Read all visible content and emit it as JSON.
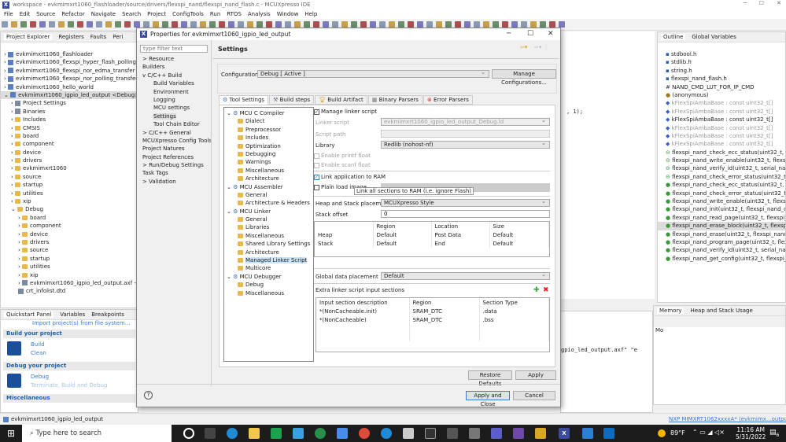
{
  "window": {
    "title": "workspace - evkmimxrt1060_flashloader/source/drivers/flexspi_nand/flexspi_nand_flash.c - MCUXpresso IDE"
  },
  "menu": [
    "File",
    "Edit",
    "Source",
    "Refactor",
    "Navigate",
    "Search",
    "Project",
    "ConfigTools",
    "Run",
    "RTOS",
    "Analysis",
    "Window",
    "Help"
  ],
  "explorer": {
    "tabs": [
      "Project Explorer",
      "Registers",
      "Faults",
      "Peri"
    ],
    "items": [
      {
        "t": "evkmimxrt1060_flashloader",
        "d": 0,
        "k": "p"
      },
      {
        "t": "evkmimxrt1060_flexspi_hyper_flash_polling_transfer",
        "d": 0,
        "k": "p"
      },
      {
        "t": "evkmimxrt1060_flexspi_nor_edma_transfer",
        "d": 0,
        "k": "p"
      },
      {
        "t": "evkmimxrt1060_flexspi_nor_polling_transfer",
        "d": 0,
        "k": "p"
      },
      {
        "t": "evkmimxrt1060_hello_world",
        "d": 0,
        "k": "p"
      },
      {
        "t": "evkmimxrt1060_igpio_led_output <Debug>",
        "d": 0,
        "k": "p",
        "sel": true
      },
      {
        "t": "Project Settings",
        "d": 1,
        "k": "g"
      },
      {
        "t": "Binaries",
        "d": 1,
        "k": "g"
      },
      {
        "t": "Includes",
        "d": 1,
        "k": "f"
      },
      {
        "t": "CMSIS",
        "d": 1,
        "k": "f"
      },
      {
        "t": "board",
        "d": 1,
        "k": "f"
      },
      {
        "t": "component",
        "d": 1,
        "k": "f"
      },
      {
        "t": "device",
        "d": 1,
        "k": "f"
      },
      {
        "t": "drivers",
        "d": 1,
        "k": "f"
      },
      {
        "t": "evkmimxrt1060",
        "d": 1,
        "k": "f"
      },
      {
        "t": "source",
        "d": 1,
        "k": "f"
      },
      {
        "t": "startup",
        "d": 1,
        "k": "f"
      },
      {
        "t": "utilities",
        "d": 1,
        "k": "f"
      },
      {
        "t": "xip",
        "d": 1,
        "k": "f"
      },
      {
        "t": "Debug",
        "d": 1,
        "k": "f"
      },
      {
        "t": "board",
        "d": 2,
        "k": "f"
      },
      {
        "t": "component",
        "d": 2,
        "k": "f"
      },
      {
        "t": "device",
        "d": 2,
        "k": "f"
      },
      {
        "t": "drivers",
        "d": 2,
        "k": "f"
      },
      {
        "t": "source",
        "d": 2,
        "k": "f"
      },
      {
        "t": "startup",
        "d": 2,
        "k": "f"
      },
      {
        "t": "utilities",
        "d": 2,
        "k": "f"
      },
      {
        "t": "xip",
        "d": 2,
        "k": "f"
      },
      {
        "t": "evkmimxrt1060_igpio_led_output.axf - [arm/le]",
        "d": 2,
        "k": "g"
      },
      {
        "t": "crt_infolist.dtd",
        "d": 2,
        "k": "g"
      }
    ]
  },
  "quickstart": {
    "tabs": [
      "Quickstart Panel",
      "Variables",
      "Breakpoints"
    ],
    "import": "Import project(s) from file system...",
    "build_header": "Build your project",
    "build": "Build",
    "clean": "Clean",
    "debug_header": "Debug your project",
    "debug": "Debug",
    "terminate": "Terminate, Build and Debug",
    "misc_header": "Miscellaneous"
  },
  "status": {
    "project": "evkmimxrt1060_igpio_led_output",
    "probe_nxp": "NXP",
    "probe_device": "MIMXRT1062xxxxA*",
    "probe_proj": "(evkmimx...output)"
  },
  "dialog": {
    "title": "Properties for evkmimxrt1060_igpio_led_output",
    "filter_placeholder": "type filter text",
    "nav": [
      {
        "t": "Resource",
        "d": 0,
        "e": ">"
      },
      {
        "t": "Builders",
        "d": 0
      },
      {
        "t": "C/C++ Build",
        "d": 0,
        "e": "v"
      },
      {
        "t": "Build Variables",
        "d": 1
      },
      {
        "t": "Environment",
        "d": 1
      },
      {
        "t": "Logging",
        "d": 1
      },
      {
        "t": "MCU settings",
        "d": 1
      },
      {
        "t": "Settings",
        "d": 1,
        "sel": true
      },
      {
        "t": "Tool Chain Editor",
        "d": 1
      },
      {
        "t": "C/C++ General",
        "d": 0,
        "e": ">"
      },
      {
        "t": "MCUXpresso Config Tools",
        "d": 0
      },
      {
        "t": "Project Natures",
        "d": 0
      },
      {
        "t": "Project References",
        "d": 0
      },
      {
        "t": "Run/Debug Settings",
        "d": 0,
        "e": ">"
      },
      {
        "t": "Task Tags",
        "d": 0
      },
      {
        "t": "Validation",
        "d": 0,
        "e": ">"
      }
    ],
    "header": "Settings",
    "config_label": "Configuration:",
    "config_value": "Debug  [ Active ]",
    "manage": "Manage Configurations...",
    "tabs": [
      "Tool Settings",
      "Build steps",
      "Build Artifact",
      "Binary Parsers",
      "Error Parsers"
    ],
    "tool_tree": [
      {
        "t": "MCU C Compiler",
        "d": 0
      },
      {
        "t": "Dialect",
        "d": 1
      },
      {
        "t": "Preprocessor",
        "d": 1
      },
      {
        "t": "Includes",
        "d": 1
      },
      {
        "t": "Optimization",
        "d": 1
      },
      {
        "t": "Debugging",
        "d": 1
      },
      {
        "t": "Warnings",
        "d": 1
      },
      {
        "t": "Miscellaneous",
        "d": 1
      },
      {
        "t": "Architecture",
        "d": 1
      },
      {
        "t": "MCU Assembler",
        "d": 0
      },
      {
        "t": "General",
        "d": 1
      },
      {
        "t": "Architecture & Headers",
        "d": 1
      },
      {
        "t": "MCU Linker",
        "d": 0
      },
      {
        "t": "General",
        "d": 1
      },
      {
        "t": "Libraries",
        "d": 1
      },
      {
        "t": "Miscellaneous",
        "d": 1
      },
      {
        "t": "Shared Library Settings",
        "d": 1
      },
      {
        "t": "Architecture",
        "d": 1
      },
      {
        "t": "Managed Linker Script",
        "d": 1,
        "sel": true
      },
      {
        "t": "Multicore",
        "d": 1
      },
      {
        "t": "MCU Debugger",
        "d": 0
      },
      {
        "t": "Debug",
        "d": 1
      },
      {
        "t": "Miscellaneous",
        "d": 1
      }
    ],
    "manage_linker": "Manage linker script",
    "linker_script_label": "Linker script",
    "linker_script_value": "evkmimxrt1060_igpio_led_output_Debug.ld",
    "script_path_label": "Script path",
    "library_label": "Library",
    "library_value": "Redlib (nohost-nf)",
    "printf_float": "Enable printf float",
    "scanf_float": "Enable scanf float",
    "link_ram": "Link application to RAM",
    "plain_load": "Plain load image",
    "tooltip": "Link all sections to RAM (i.e. ignore Flash)",
    "heap_stack_label": "Heap and Stack placement",
    "heap_stack_value": "MCUXpresso Style",
    "stack_offset_label": "Stack offset",
    "stack_offset_value": "0",
    "hs_table": {
      "headers": [
        "",
        "Region",
        "Location",
        "Size"
      ],
      "rows": [
        [
          "Heap",
          "Default",
          "Post Data",
          "Default"
        ],
        [
          "Stack",
          "Default",
          "End",
          "Default"
        ]
      ]
    },
    "global_label": "Global data placement",
    "global_value": "Default",
    "extra_label": "Extra linker script input sections",
    "extra_table": {
      "headers": [
        "Input section description",
        "Region",
        "Section Type"
      ],
      "rows": [
        [
          "*(NonCacheable.init)",
          "SRAM_DTC",
          ".data"
        ],
        [
          "*(NonCacheable)",
          "SRAM_DTC",
          ".bss"
        ]
      ]
    },
    "restore": "Restore Defaults",
    "apply": "Apply",
    "apply_close": "Apply and Close",
    "cancel": "Cancel"
  },
  "editor": {
    "code_fragment": ", 1);",
    "console_fragment": "gpio_led_output.axf\" \"e"
  },
  "outline": {
    "tabs": [
      "Outline",
      "Global Variables"
    ],
    "items": [
      {
        "t": "stdbool.h",
        "k": "inc"
      },
      {
        "t": "stdlib.h",
        "k": "inc"
      },
      {
        "t": "string.h",
        "k": "inc"
      },
      {
        "t": "flexspi_nand_flash.h",
        "k": "inc"
      },
      {
        "t": "NAND_CMD_LUT_FOR_IP_CMD",
        "k": "def"
      },
      {
        "t": "(anonymous)",
        "k": "anon"
      },
      {
        "t": "kFlexSpiAmbaBase : const uint32_t[]",
        "k": "var",
        "dim": true
      },
      {
        "t": "kFlexSpiAmbaBase : const uint32_t[]",
        "k": "var",
        "dim": true
      },
      {
        "t": "kFlexSpiAmbaBase : const uint32_t[]",
        "k": "var"
      },
      {
        "t": "kFlexSpiAmbaBase : const uint32_t[]",
        "k": "var",
        "dim": true
      },
      {
        "t": "kFlexSpiAmbaBase : const uint32_t[]",
        "k": "var",
        "dim": true
      },
      {
        "t": "kFlexSpiAmbaBase : const uint32_t[]",
        "k": "var",
        "dim": true
      },
      {
        "t": "flexspi_nand_check_ecc_status(uint32_t, flexspi_nand_config_t*)",
        "k": "sfn"
      },
      {
        "t": "flexspi_nand_write_enable(uint32_t, flexspi_nand_config_t*)",
        "k": "sfn"
      },
      {
        "t": "flexspi_nand_verify_id(uint32_t, serial_nand_config_t*)",
        "k": "sfn"
      },
      {
        "t": "flexspi_nand_check_error_status(uint32_t, flexspi_nand_config_t*)",
        "k": "sfn"
      },
      {
        "t": "flexspi_nand_check_ecc_status(uint32_t, flexspi_nand_config_t*)",
        "k": "fn"
      },
      {
        "t": "flexspi_nand_check_error_status(uint32_t, flexspi_nand_config_t*)",
        "k": "fn"
      },
      {
        "t": "flexspi_nand_write_enable(uint32_t, flexspi_nand_config_t*)",
        "k": "fn"
      },
      {
        "t": "flexspi_nand_init(uint32_t, flexspi_nand_config_t*)",
        "k": "fn"
      },
      {
        "t": "flexspi_nand_read_page(uint32_t, flexspi_nand_config_t*)",
        "k": "fn"
      },
      {
        "t": "flexspi_nand_erase_block(uint32_t, flexspi_nand_config_t*)",
        "k": "fn",
        "sel": true
      },
      {
        "t": "flexspi_nand_erase(uint32_t, flexspi_nand_config_t*)",
        "k": "fn"
      },
      {
        "t": "flexspi_nand_program_page(uint32_t, flexspi_nand_config_t*)",
        "k": "fn"
      },
      {
        "t": "flexspi_nand_verify_id(uint32_t, serial_nand_config_t*)",
        "k": "fn"
      },
      {
        "t": "flexspi_nand_get_config(uint32_t, flexspi_nand_config_t*)",
        "k": "fn"
      }
    ]
  },
  "memory": {
    "tabs": [
      "Memory",
      "Heap and Stack Usage"
    ],
    "monitor": "Mo"
  },
  "taskbar": {
    "search_placeholder": "Type here to search",
    "weather": "89°F",
    "time": "11:16 AM",
    "date": "5/31/2022",
    "notifications": "6"
  }
}
